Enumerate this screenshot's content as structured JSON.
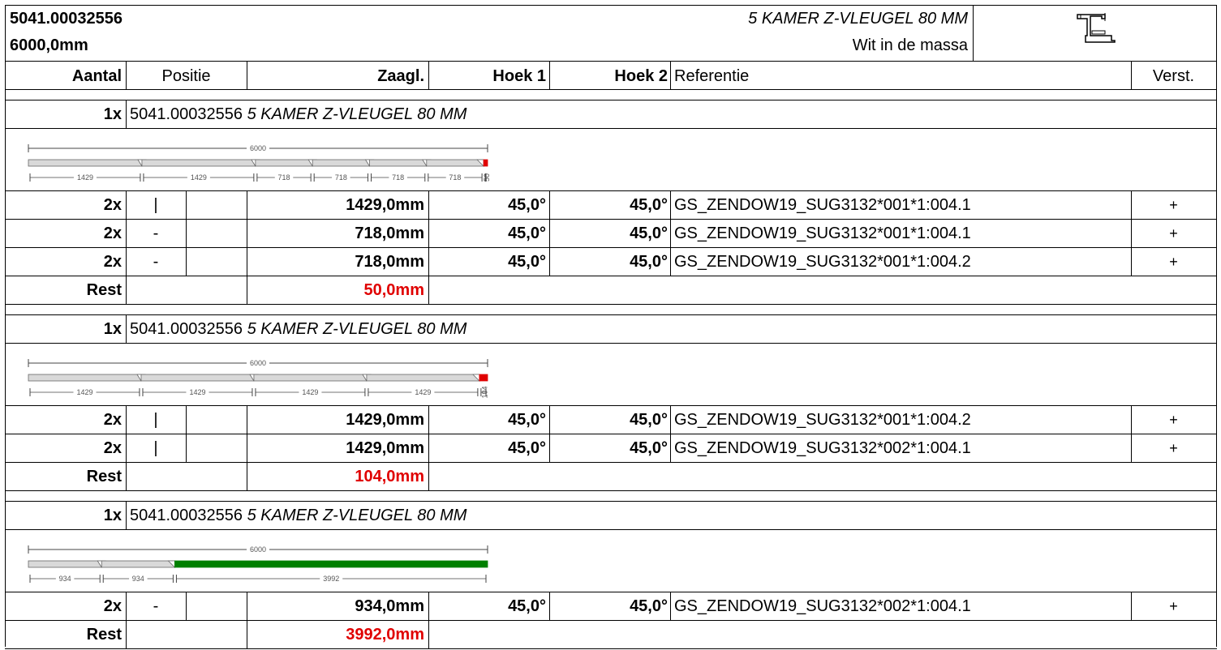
{
  "header": {
    "article": "5041.00032556",
    "length": "6000,0mm",
    "profile_name": "5 KAMER Z-VLEUGEL 80 MM",
    "color": "Wit in de massa",
    "profile_icon": "z-profile-section-icon"
  },
  "columns": {
    "aantal": "Aantal",
    "positie": "Positie",
    "zaagl": "Zaagl.",
    "hoek1": "Hoek 1",
    "hoek2": "Hoek 2",
    "referentie": "Referentie",
    "verst": "Verst."
  },
  "bars": [
    {
      "count": "1x",
      "article": "5041.00032556",
      "name": "5 KAMER Z-VLEUGEL 80 MM",
      "total_label": "6000",
      "segments": [
        {
          "length": 1429,
          "label": "1429",
          "kind": "cut"
        },
        {
          "length": 1429,
          "label": "1429",
          "kind": "cut"
        },
        {
          "length": 718,
          "label": "718",
          "kind": "cut"
        },
        {
          "length": 718,
          "label": "718",
          "kind": "cut"
        },
        {
          "length": 718,
          "label": "718",
          "kind": "cut"
        },
        {
          "length": 718,
          "label": "718",
          "kind": "cut"
        },
        {
          "length": 50,
          "label": "50",
          "kind": "waste"
        }
      ],
      "rows": [
        {
          "aantal": "2x",
          "positie": "|",
          "zaagl": "1429,0mm",
          "hoek1": "45,0°",
          "hoek2": "45,0°",
          "referentie": "GS_ZENDOW19_SUG3132*001*1:004.1",
          "verst": "+"
        },
        {
          "aantal": "2x",
          "positie": "-",
          "zaagl": "718,0mm",
          "hoek1": "45,0°",
          "hoek2": "45,0°",
          "referentie": "GS_ZENDOW19_SUG3132*001*1:004.1",
          "verst": "+"
        },
        {
          "aantal": "2x",
          "positie": "-",
          "zaagl": "718,0mm",
          "hoek1": "45,0°",
          "hoek2": "45,0°",
          "referentie": "GS_ZENDOW19_SUG3132*001*1:004.2",
          "verst": "+"
        }
      ],
      "rest_label": "Rest",
      "rest_value": "50,0mm"
    },
    {
      "count": "1x",
      "article": "5041.00032556",
      "name": "5 KAMER Z-VLEUGEL 80 MM",
      "total_label": "6000",
      "segments": [
        {
          "length": 1429,
          "label": "1429",
          "kind": "cut"
        },
        {
          "length": 1429,
          "label": "1429",
          "kind": "cut"
        },
        {
          "length": 1429,
          "label": "1429",
          "kind": "cut"
        },
        {
          "length": 1429,
          "label": "1429",
          "kind": "cut"
        },
        {
          "length": 104,
          "label": "104",
          "kind": "waste"
        }
      ],
      "rows": [
        {
          "aantal": "2x",
          "positie": "|",
          "zaagl": "1429,0mm",
          "hoek1": "45,0°",
          "hoek2": "45,0°",
          "referentie": "GS_ZENDOW19_SUG3132*001*1:004.2",
          "verst": "+"
        },
        {
          "aantal": "2x",
          "positie": "|",
          "zaagl": "1429,0mm",
          "hoek1": "45,0°",
          "hoek2": "45,0°",
          "referentie": "GS_ZENDOW19_SUG3132*002*1:004.1",
          "verst": "+"
        }
      ],
      "rest_label": "Rest",
      "rest_value": "104,0mm"
    },
    {
      "count": "1x",
      "article": "5041.00032556",
      "name": "5 KAMER Z-VLEUGEL 80 MM",
      "total_label": "6000",
      "segments": [
        {
          "length": 934,
          "label": "934",
          "kind": "cut"
        },
        {
          "length": 934,
          "label": "934",
          "kind": "cut"
        },
        {
          "length": 3992,
          "label": "3992",
          "kind": "rest"
        }
      ],
      "rows": [
        {
          "aantal": "2x",
          "positie": "-",
          "zaagl": "934,0mm",
          "hoek1": "45,0°",
          "hoek2": "45,0°",
          "referentie": "GS_ZENDOW19_SUG3132*002*1:004.1",
          "verst": "+"
        }
      ],
      "rest_label": "Rest",
      "rest_value": "3992,0mm"
    }
  ],
  "colors": {
    "cut": "#d9d9d9",
    "waste": "#e00000",
    "rest": "#008000",
    "rest_text": "#e00000"
  }
}
